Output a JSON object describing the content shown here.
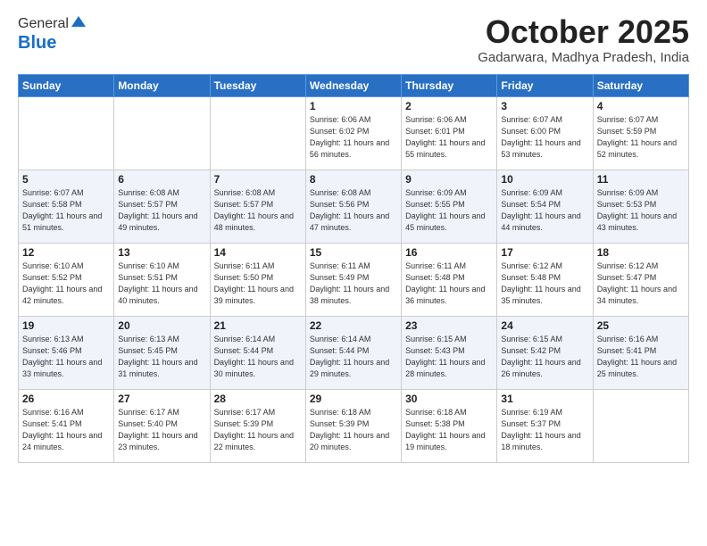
{
  "header": {
    "logo_general": "General",
    "logo_blue": "Blue",
    "month_title": "October 2025",
    "subtitle": "Gadarwara, Madhya Pradesh, India"
  },
  "days_of_week": [
    "Sunday",
    "Monday",
    "Tuesday",
    "Wednesday",
    "Thursday",
    "Friday",
    "Saturday"
  ],
  "weeks": [
    [
      {
        "day": "",
        "detail": ""
      },
      {
        "day": "",
        "detail": ""
      },
      {
        "day": "",
        "detail": ""
      },
      {
        "day": "1",
        "detail": "Sunrise: 6:06 AM\nSunset: 6:02 PM\nDaylight: 11 hours\nand 56 minutes."
      },
      {
        "day": "2",
        "detail": "Sunrise: 6:06 AM\nSunset: 6:01 PM\nDaylight: 11 hours\nand 55 minutes."
      },
      {
        "day": "3",
        "detail": "Sunrise: 6:07 AM\nSunset: 6:00 PM\nDaylight: 11 hours\nand 53 minutes."
      },
      {
        "day": "4",
        "detail": "Sunrise: 6:07 AM\nSunset: 5:59 PM\nDaylight: 11 hours\nand 52 minutes."
      }
    ],
    [
      {
        "day": "5",
        "detail": "Sunrise: 6:07 AM\nSunset: 5:58 PM\nDaylight: 11 hours\nand 51 minutes."
      },
      {
        "day": "6",
        "detail": "Sunrise: 6:08 AM\nSunset: 5:57 PM\nDaylight: 11 hours\nand 49 minutes."
      },
      {
        "day": "7",
        "detail": "Sunrise: 6:08 AM\nSunset: 5:57 PM\nDaylight: 11 hours\nand 48 minutes."
      },
      {
        "day": "8",
        "detail": "Sunrise: 6:08 AM\nSunset: 5:56 PM\nDaylight: 11 hours\nand 47 minutes."
      },
      {
        "day": "9",
        "detail": "Sunrise: 6:09 AM\nSunset: 5:55 PM\nDaylight: 11 hours\nand 45 minutes."
      },
      {
        "day": "10",
        "detail": "Sunrise: 6:09 AM\nSunset: 5:54 PM\nDaylight: 11 hours\nand 44 minutes."
      },
      {
        "day": "11",
        "detail": "Sunrise: 6:09 AM\nSunset: 5:53 PM\nDaylight: 11 hours\nand 43 minutes."
      }
    ],
    [
      {
        "day": "12",
        "detail": "Sunrise: 6:10 AM\nSunset: 5:52 PM\nDaylight: 11 hours\nand 42 minutes."
      },
      {
        "day": "13",
        "detail": "Sunrise: 6:10 AM\nSunset: 5:51 PM\nDaylight: 11 hours\nand 40 minutes."
      },
      {
        "day": "14",
        "detail": "Sunrise: 6:11 AM\nSunset: 5:50 PM\nDaylight: 11 hours\nand 39 minutes."
      },
      {
        "day": "15",
        "detail": "Sunrise: 6:11 AM\nSunset: 5:49 PM\nDaylight: 11 hours\nand 38 minutes."
      },
      {
        "day": "16",
        "detail": "Sunrise: 6:11 AM\nSunset: 5:48 PM\nDaylight: 11 hours\nand 36 minutes."
      },
      {
        "day": "17",
        "detail": "Sunrise: 6:12 AM\nSunset: 5:48 PM\nDaylight: 11 hours\nand 35 minutes."
      },
      {
        "day": "18",
        "detail": "Sunrise: 6:12 AM\nSunset: 5:47 PM\nDaylight: 11 hours\nand 34 minutes."
      }
    ],
    [
      {
        "day": "19",
        "detail": "Sunrise: 6:13 AM\nSunset: 5:46 PM\nDaylight: 11 hours\nand 33 minutes."
      },
      {
        "day": "20",
        "detail": "Sunrise: 6:13 AM\nSunset: 5:45 PM\nDaylight: 11 hours\nand 31 minutes."
      },
      {
        "day": "21",
        "detail": "Sunrise: 6:14 AM\nSunset: 5:44 PM\nDaylight: 11 hours\nand 30 minutes."
      },
      {
        "day": "22",
        "detail": "Sunrise: 6:14 AM\nSunset: 5:44 PM\nDaylight: 11 hours\nand 29 minutes."
      },
      {
        "day": "23",
        "detail": "Sunrise: 6:15 AM\nSunset: 5:43 PM\nDaylight: 11 hours\nand 28 minutes."
      },
      {
        "day": "24",
        "detail": "Sunrise: 6:15 AM\nSunset: 5:42 PM\nDaylight: 11 hours\nand 26 minutes."
      },
      {
        "day": "25",
        "detail": "Sunrise: 6:16 AM\nSunset: 5:41 PM\nDaylight: 11 hours\nand 25 minutes."
      }
    ],
    [
      {
        "day": "26",
        "detail": "Sunrise: 6:16 AM\nSunset: 5:41 PM\nDaylight: 11 hours\nand 24 minutes."
      },
      {
        "day": "27",
        "detail": "Sunrise: 6:17 AM\nSunset: 5:40 PM\nDaylight: 11 hours\nand 23 minutes."
      },
      {
        "day": "28",
        "detail": "Sunrise: 6:17 AM\nSunset: 5:39 PM\nDaylight: 11 hours\nand 22 minutes."
      },
      {
        "day": "29",
        "detail": "Sunrise: 6:18 AM\nSunset: 5:39 PM\nDaylight: 11 hours\nand 20 minutes."
      },
      {
        "day": "30",
        "detail": "Sunrise: 6:18 AM\nSunset: 5:38 PM\nDaylight: 11 hours\nand 19 minutes."
      },
      {
        "day": "31",
        "detail": "Sunrise: 6:19 AM\nSunset: 5:37 PM\nDaylight: 11 hours\nand 18 minutes."
      },
      {
        "day": "",
        "detail": ""
      }
    ]
  ]
}
